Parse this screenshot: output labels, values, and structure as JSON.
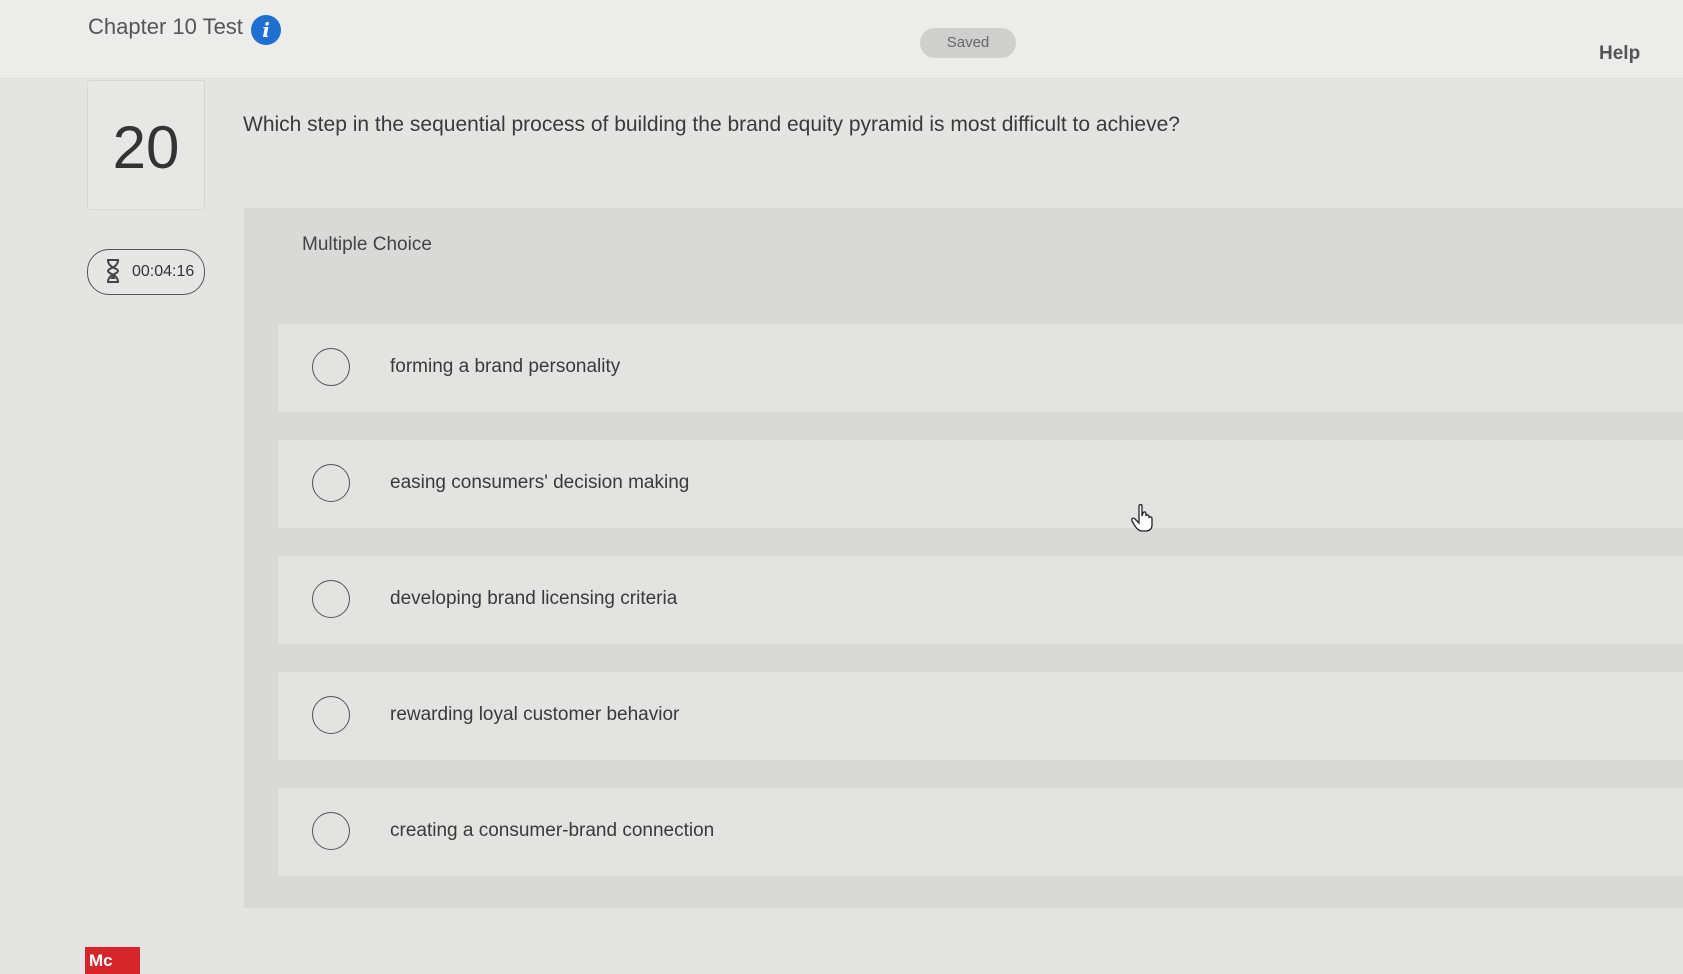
{
  "header": {
    "test_title": "Chapter 10 Test",
    "info_glyph": "i",
    "saved_status": "Saved",
    "help_label": "Help"
  },
  "question": {
    "number": "20",
    "text": "Which step in the sequential process of building the brand equity pyramid is most difficult to achieve?",
    "type_label": "Multiple Choice",
    "options": [
      {
        "label": "forming a brand personality"
      },
      {
        "label": "easing consumers' decision making"
      },
      {
        "label": "developing brand licensing criteria"
      },
      {
        "label": "rewarding loyal customer behavior"
      },
      {
        "label": "creating a consumer-brand connection"
      }
    ]
  },
  "timer": {
    "value": "00:04:16",
    "icon": "hourglass-icon"
  },
  "footer": {
    "brand_logo_text": "Mc"
  },
  "colors": {
    "info_blue": "#1f6fd1",
    "brand_red": "#d5242a"
  }
}
